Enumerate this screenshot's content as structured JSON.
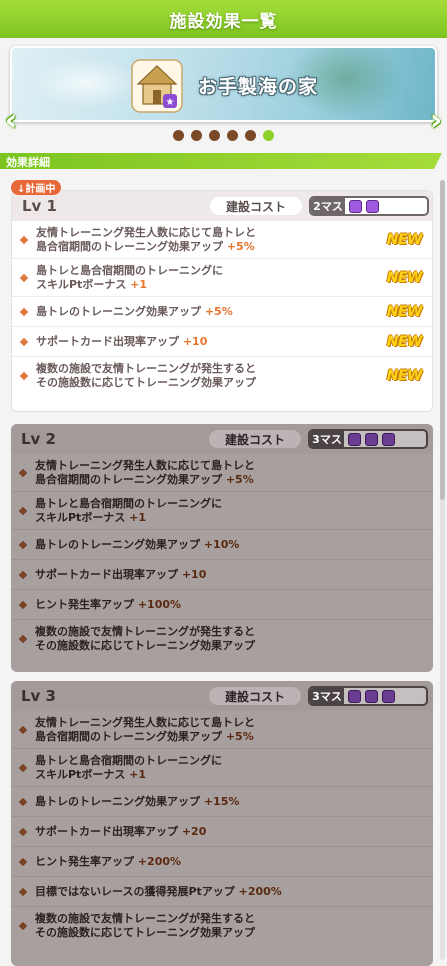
{
  "header": {
    "title": "施設効果一覧"
  },
  "banner": {
    "facility_name": "お手製海の家"
  },
  "pager": {
    "count": 6,
    "active_index": 5
  },
  "section": {
    "label": "効果詳細"
  },
  "cards": [
    {
      "level": "Lv 1",
      "plan_badge": "↓計画中",
      "cost_label": "建設コスト",
      "cost_masu": "2マス",
      "cost_squares": 2,
      "effects": [
        {
          "text": "友情トレーニング発生人数に応じて島トレと\n島合宿期間のトレーニング効果アップ",
          "value": "+5%",
          "new": "NEW"
        },
        {
          "text": "島トレと島合宿期間のトレーニングに\nスキルPtボーナス",
          "value": "+1",
          "new": "NEW"
        },
        {
          "text": "島トレのトレーニング効果アップ",
          "value": "+5%",
          "new": "NEW"
        },
        {
          "text": "サポートカード出現率アップ",
          "value": "+10",
          "new": "NEW"
        },
        {
          "text": "複数の施設で友情トレーニングが発生すると\nその施設数に応じてトレーニング効果アップ",
          "value": "",
          "new": "NEW"
        }
      ]
    },
    {
      "level": "Lv 2",
      "cost_label": "建設コスト",
      "cost_masu": "3マス",
      "cost_squares": 3,
      "effects": [
        {
          "text": "友情トレーニング発生人数に応じて島トレと\n島合宿期間のトレーニング効果アップ",
          "value": "+5%"
        },
        {
          "text": "島トレと島合宿期間のトレーニングに\nスキルPtボーナス",
          "value": "+1"
        },
        {
          "text": "島トレのトレーニング効果アップ",
          "value": "+10%"
        },
        {
          "text": "サポートカード出現率アップ",
          "value": "+10"
        },
        {
          "text": "ヒント発生率アップ",
          "value": "+100%"
        },
        {
          "text": "複数の施設で友情トレーニングが発生すると\nその施設数に応じてトレーニング効果アップ",
          "value": ""
        }
      ]
    },
    {
      "level": "Lv 3",
      "cost_label": "建設コスト",
      "cost_masu": "3マス",
      "cost_squares": 3,
      "effects": [
        {
          "text": "友情トレーニング発生人数に応じて島トレと\n島合宿期間のトレーニング効果アップ",
          "value": "+5%"
        },
        {
          "text": "島トレと島合宿期間のトレーニングに\nスキルPtボーナス",
          "value": "+1"
        },
        {
          "text": "島トレのトレーニング効果アップ",
          "value": "+15%"
        },
        {
          "text": "サポートカード出現率アップ",
          "value": "+20"
        },
        {
          "text": "ヒント発生率アップ",
          "value": "+200%"
        },
        {
          "text": "目標ではないレースの獲得発展Ptアップ",
          "value": "+200%"
        },
        {
          "text": "複数の施設で友情トレーニングが発生すると\nその施設数に応じてトレーニング効果アップ",
          "value": ""
        }
      ]
    }
  ]
}
